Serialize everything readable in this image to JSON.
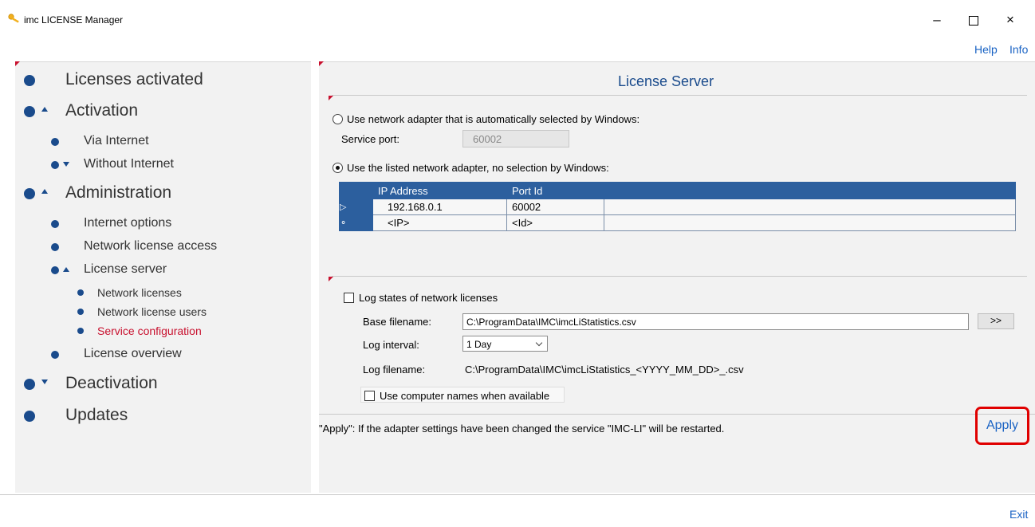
{
  "window": {
    "title": "imc LICENSE Manager",
    "controls": {
      "minimize": "–",
      "close": "×"
    }
  },
  "toplinks": {
    "help": "Help",
    "info": "Info"
  },
  "sidebar": {
    "licenses_activated": "Licenses activated",
    "activation": "Activation",
    "via_internet": "Via Internet",
    "without_internet": "Without Internet",
    "administration": "Administration",
    "internet_options": "Internet options",
    "network_license_access": "Network license access",
    "license_server": "License server",
    "network_licenses": "Network licenses",
    "network_license_users": "Network license users",
    "service_configuration": "Service configuration",
    "license_overview": "License overview",
    "deactivation": "Deactivation",
    "updates": "Updates",
    "active_item": "Service configuration"
  },
  "main": {
    "title": "License Server",
    "auto_adapter_label": "Use network adapter that is automatically selected by Windows:",
    "service_port_label": "Service port:",
    "service_port_value": "60002",
    "listed_adapter_label": "Use the listed network adapter, no selection by Windows:",
    "selected_option": "listed",
    "table": {
      "headers": [
        "IP Address",
        "Port Id"
      ],
      "rows": [
        {
          "marker": "▷",
          "ip": "192.168.0.1",
          "port": "60002"
        },
        {
          "marker": "⚬",
          "ip": "<IP>",
          "port": "<Id>"
        }
      ]
    },
    "log_states_label": "Log states of network licenses",
    "log_states_checked": false,
    "base_filename_label": "Base filename:",
    "base_filename_value": "C:\\ProgramData\\IMC\\imcLiStatistics.csv",
    "browse_label": ">>",
    "log_interval_label": "Log interval:",
    "log_interval_value": "1 Day",
    "log_filename_label": "Log filename:",
    "log_filename_value": "C:\\ProgramData\\IMC\\imcLiStatistics_<YYYY_MM_DD>_.csv",
    "computer_names_label": "Use computer names when available",
    "computer_names_checked": false,
    "note": "\"Apply\": If the adapter settings have been changed the service \"IMC-LI\" will be restarted.",
    "apply_label": "Apply"
  },
  "footer": {
    "exit_label": "Exit"
  },
  "colors": {
    "accent_blue": "#1a4b8c",
    "link_blue": "#1a63c4",
    "active_red": "#c8102e",
    "grid_header": "#2c5f9e",
    "highlight_box": "#e00000",
    "panel_bg": "#f2f2f2"
  }
}
